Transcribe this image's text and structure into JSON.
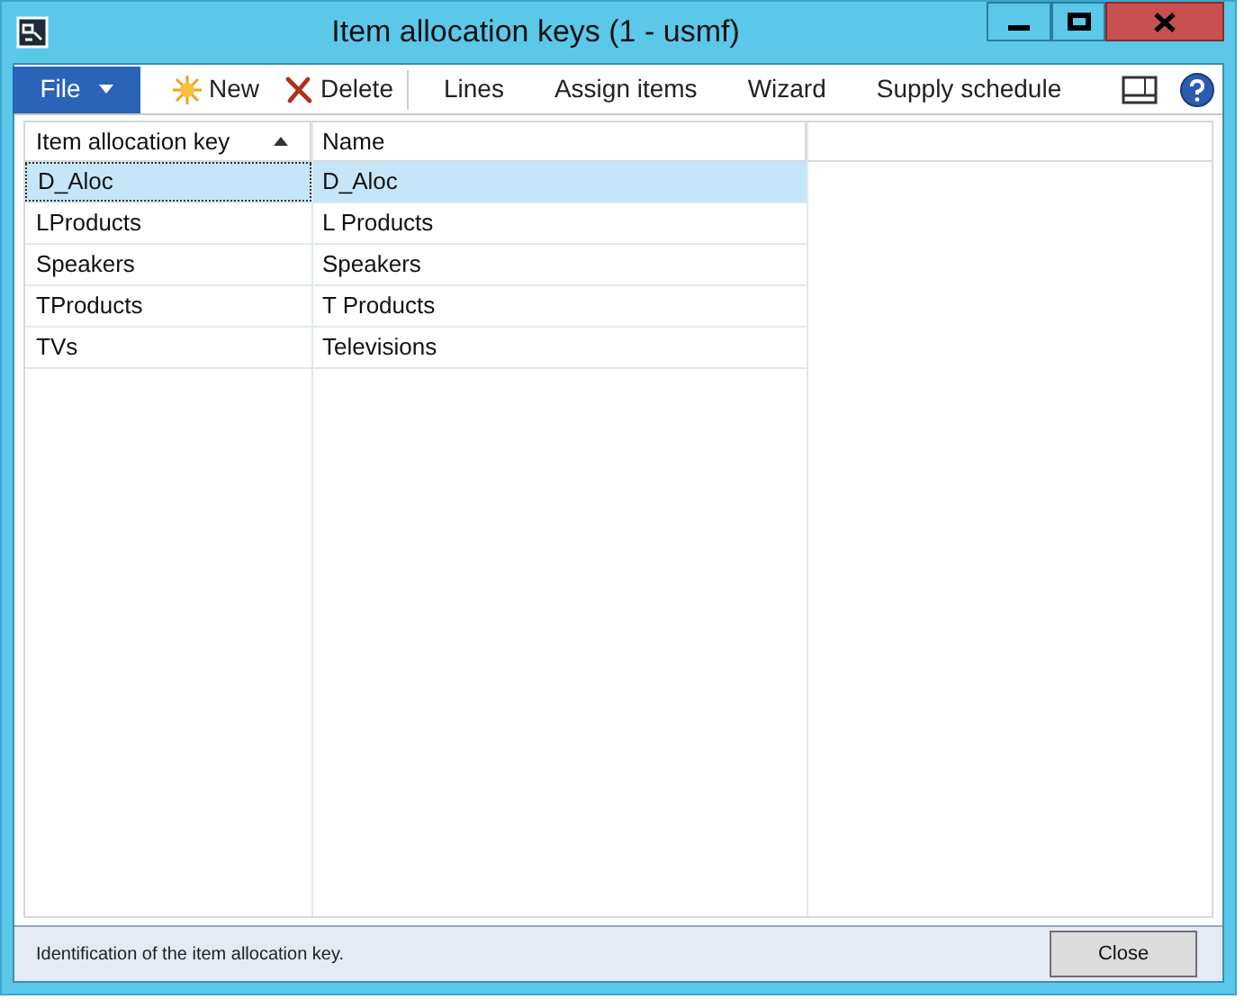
{
  "window": {
    "title": "Item allocation keys (1 - usmf)"
  },
  "toolbar": {
    "file_menu": "File",
    "buttons": [
      {
        "kind": "new",
        "label": "New"
      },
      {
        "kind": "delete",
        "label": "Delete"
      },
      {
        "kind": "plain",
        "label": "Lines"
      },
      {
        "kind": "plain",
        "label": "Assign items"
      },
      {
        "kind": "plain",
        "label": "Wizard"
      },
      {
        "kind": "plain",
        "label": "Supply schedule"
      }
    ]
  },
  "table": {
    "columns": [
      {
        "label": "Item allocation key",
        "sorted": true
      },
      {
        "label": "Name",
        "sorted": false
      }
    ],
    "rows": [
      {
        "cells": [
          "D_Aloc",
          "D_Aloc"
        ],
        "selected": true
      },
      {
        "cells": [
          "LProducts",
          "L Products"
        ],
        "selected": false
      },
      {
        "cells": [
          "Speakers",
          "Speakers"
        ],
        "selected": false
      },
      {
        "cells": [
          "TProducts",
          "T Products"
        ],
        "selected": false
      },
      {
        "cells": [
          "TVs",
          "Televisions"
        ],
        "selected": false
      }
    ]
  },
  "status_bar": {
    "text": "Identification of the item allocation key.",
    "close_button": "Close"
  }
}
